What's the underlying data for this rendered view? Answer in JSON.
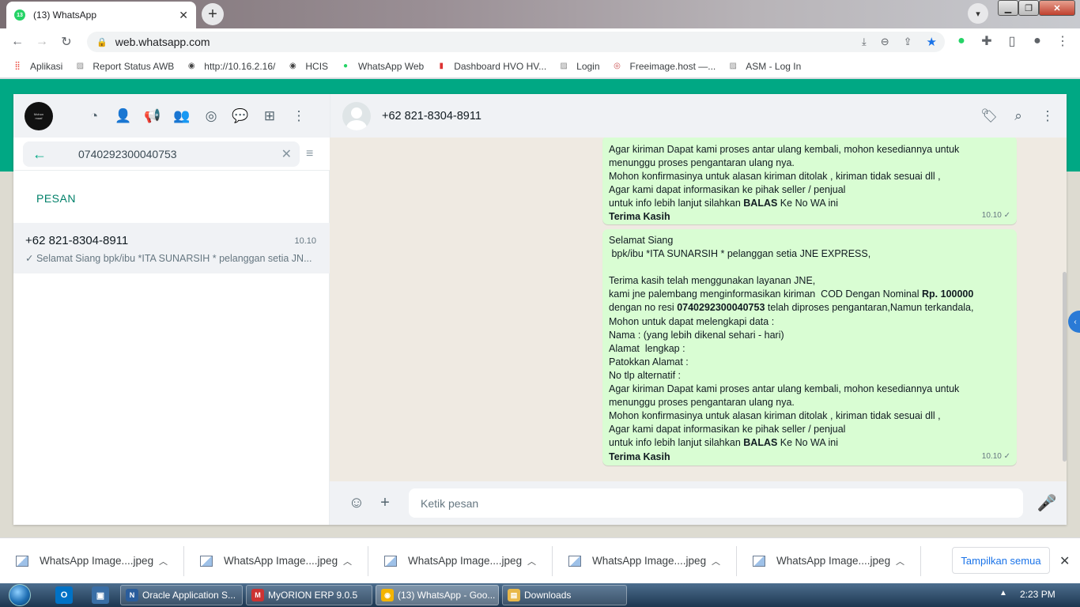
{
  "browser": {
    "tab_title": "(13) WhatsApp",
    "tab_badge": "13",
    "url": "web.whatsapp.com",
    "bookmarks": [
      {
        "label": "Aplikasi",
        "icon": "apps-grid-icon"
      },
      {
        "label": "Report Status AWB",
        "icon": "page-icon"
      },
      {
        "label": "http://10.16.2.16/",
        "icon": "globe-icon"
      },
      {
        "label": "HCIS",
        "icon": "globe-icon"
      },
      {
        "label": "WhatsApp Web",
        "icon": "whatsapp-icon"
      },
      {
        "label": "Dashboard HVO HV...",
        "icon": "dashboard-icon"
      },
      {
        "label": "Login",
        "icon": "page-icon"
      },
      {
        "label": "Freeimage.host —...",
        "icon": "freeimage-icon"
      },
      {
        "label": "ASM - Log In",
        "icon": "page-icon"
      }
    ]
  },
  "sidebar": {
    "search_value": "0740292300040753",
    "section_label": "PESAN",
    "result": {
      "name": "+62 821-8304-8911",
      "time": "10.10",
      "preview": "✓ Selamat Siang   bpk/ibu *ITA SUNARSIH * pelanggan setia JN..."
    }
  },
  "chat": {
    "contact": "+62 821-8304-8911",
    "messages": [
      {
        "time": "10.10",
        "lines": [
          [
            {
              "t": "Agar kiriman Dapat kami proses antar ulang kembali, mohon kesediannya untuk"
            }
          ],
          [
            {
              "t": "menunggu proses pengantaran ulang nya."
            }
          ],
          [
            {
              "t": "Mohon konfirmasinya untuk alasan kiriman ditolak , kiriman tidak sesuai dll ,"
            }
          ],
          [
            {
              "t": "Agar kami dapat informasikan ke pihak seller / penjual"
            }
          ],
          [
            {
              "t": "untuk info lebih lanjut silahkan "
            },
            {
              "t": "BALAS",
              "b": true
            },
            {
              "t": " Ke No WA ini"
            }
          ],
          [
            {
              "t": "Terima Kasih",
              "b": true
            }
          ]
        ]
      },
      {
        "time": "10.10",
        "lines": [
          [
            {
              "t": "Selamat Siang"
            }
          ],
          [
            {
              "t": " bpk/ibu *ITA SUNARSIH * pelanggan setia JNE EXPRESS,"
            }
          ],
          [
            {
              "t": ""
            }
          ],
          [
            {
              "t": "Terima kasih telah menggunakan layanan JNE,"
            }
          ],
          [
            {
              "t": "kami jne palembang menginformasikan kiriman  COD Dengan Nominal "
            },
            {
              "t": "Rp. 100000",
              "b": true
            }
          ],
          [
            {
              "t": "dengan no resi "
            },
            {
              "t": "0740292300040753",
              "b": true
            },
            {
              "t": " telah diproses pengantaran,Namun terkandala,"
            }
          ],
          [
            {
              "t": "Mohon untuk dapat melengkapi data :"
            }
          ],
          [
            {
              "t": "Nama : (yang lebih dikenal sehari - hari)"
            }
          ],
          [
            {
              "t": "Alamat  lengkap :"
            }
          ],
          [
            {
              "t": "Patokkan Alamat :"
            }
          ],
          [
            {
              "t": "No tlp alternatif :"
            }
          ],
          [
            {
              "t": "Agar kiriman Dapat kami proses antar ulang kembali, mohon kesediannya untuk"
            }
          ],
          [
            {
              "t": "menunggu proses pengantaran ulang nya."
            }
          ],
          [
            {
              "t": "Mohon konfirmasinya untuk alasan kiriman ditolak , kiriman tidak sesuai dll ,"
            }
          ],
          [
            {
              "t": "Agar kami dapat informasikan ke pihak seller / penjual"
            }
          ],
          [
            {
              "t": "untuk info lebih lanjut silahkan "
            },
            {
              "t": "BALAS",
              "b": true
            },
            {
              "t": " Ke No WA ini"
            }
          ],
          [
            {
              "t": "Terima Kasih",
              "b": true
            }
          ]
        ]
      }
    ],
    "input_placeholder": "Ketik pesan"
  },
  "downloads": {
    "items": [
      "WhatsApp Image....jpeg",
      "WhatsApp Image....jpeg",
      "WhatsApp Image....jpeg",
      "WhatsApp Image....jpeg",
      "WhatsApp Image....jpeg"
    ],
    "show_all": "Tampilkan semua"
  },
  "taskbar": {
    "apps": [
      "Oracle Application S...",
      "MyORION ERP 9.0.5",
      "(13) WhatsApp - Goo...",
      "Downloads"
    ],
    "clock": "2:23 PM"
  },
  "colors": {
    "accent": "#00a884",
    "bubble": "#d9fdd3",
    "chat_bg": "#efeae2"
  }
}
